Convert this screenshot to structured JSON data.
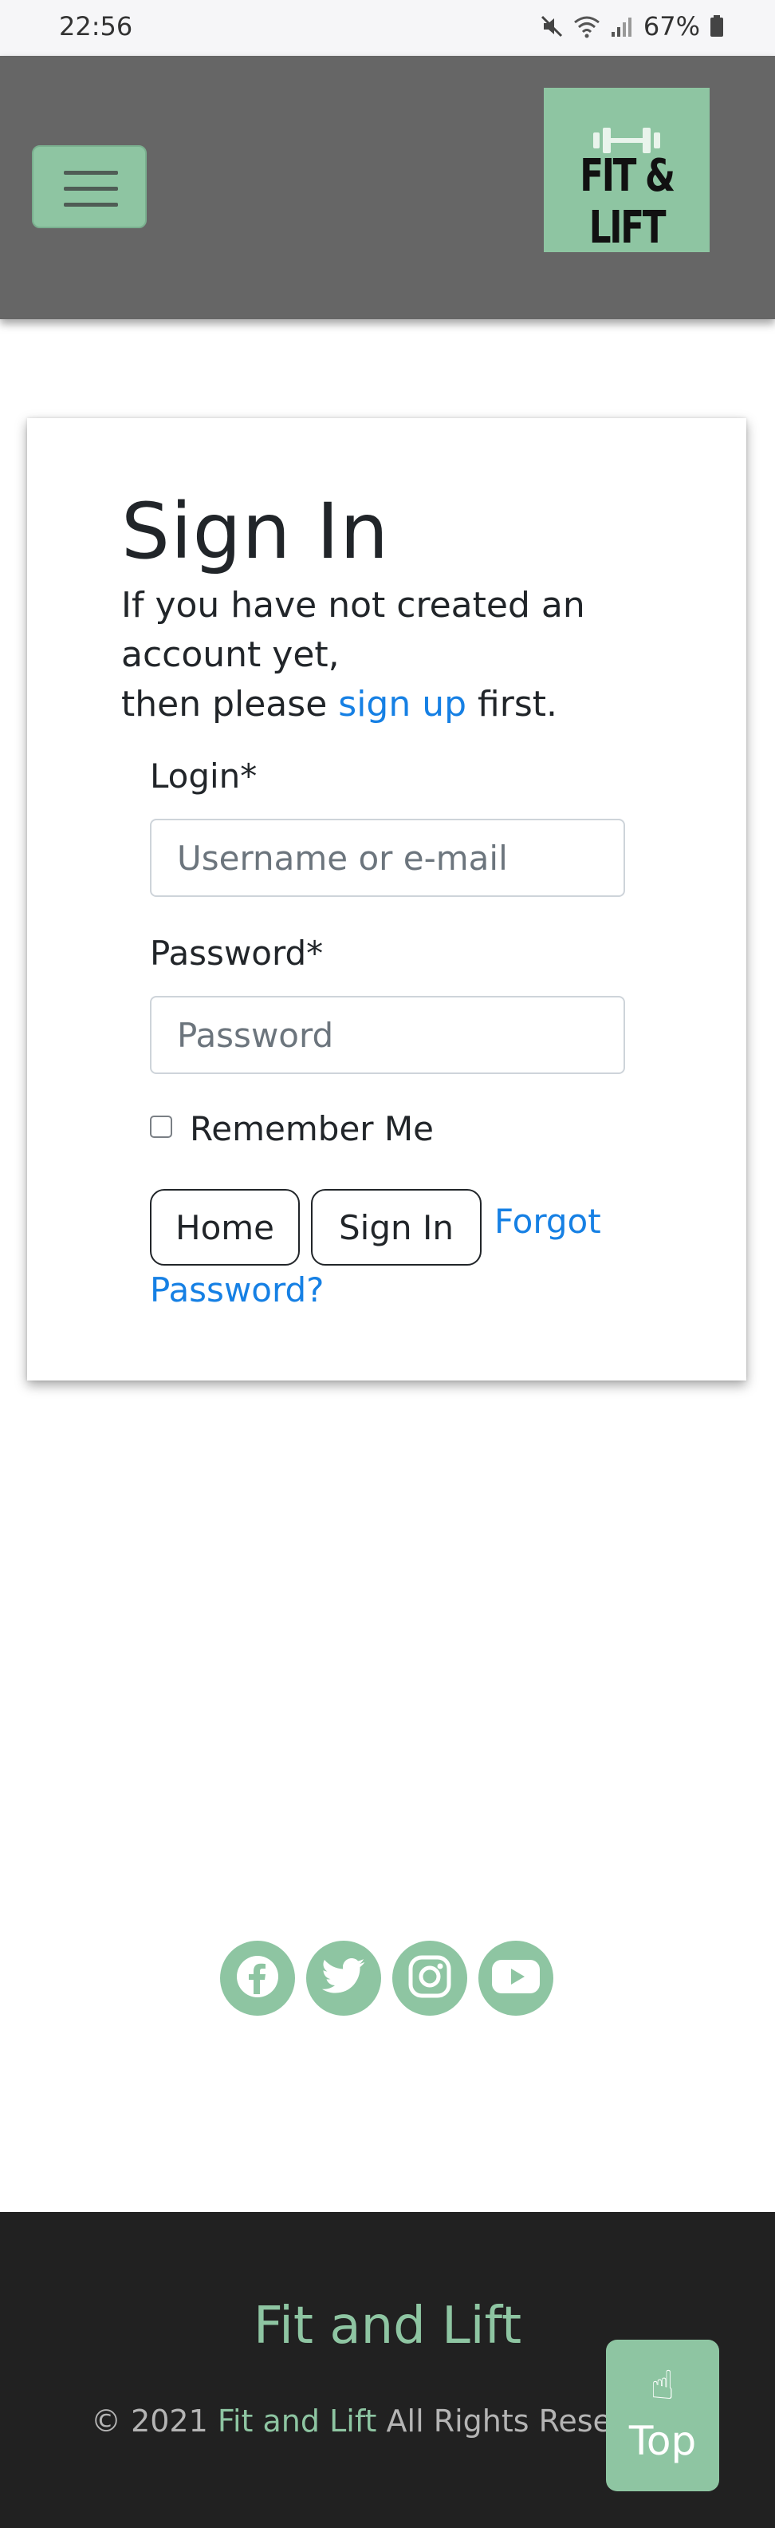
{
  "status_bar": {
    "time": "22:56",
    "battery": "67%"
  },
  "navbar": {
    "menu_icon": "hamburger-menu-icon",
    "logo_text": "FIT & LIFT",
    "logo_icon": "dumbbell-icon",
    "accent_color": "#8ec5a2",
    "bg_color": "#666666"
  },
  "signin": {
    "title": "Sign In",
    "intro_line1": "If you have not created an account yet,",
    "intro_prefix": "then please",
    "signup_link": "sign up",
    "intro_suffix": "first.",
    "login_label": "Login*",
    "login_placeholder": "Username or e-mail",
    "password_label": "Password*",
    "password_placeholder": "Password",
    "remember_label": "Remember Me",
    "home_button": "Home",
    "signin_button": "Sign In",
    "forgot_line1": "Forgot",
    "forgot_line2": "Password?"
  },
  "social": {
    "icons": [
      "facebook-icon",
      "twitter-icon",
      "instagram-icon",
      "youtube-icon"
    ]
  },
  "footer": {
    "title": "Fit and Lift",
    "copy_prefix": "© 2021",
    "copy_brand": "Fit and Lift",
    "copy_suffix": "All Rights Reserved",
    "top_emoji": "☝",
    "top_label": "Top"
  }
}
